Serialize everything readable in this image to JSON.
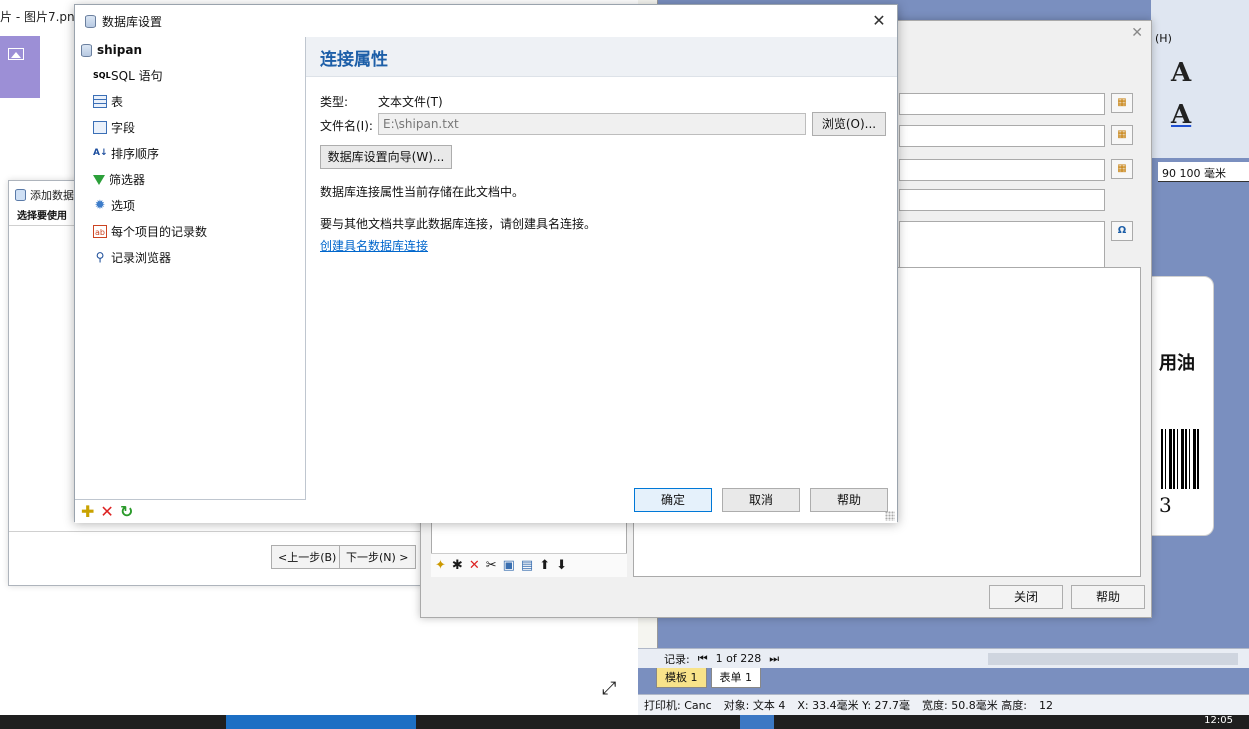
{
  "background": {
    "viewer_title": "片 - 图片7.png",
    "wizard": {
      "title": "添加数据",
      "subtitle": "选择要使用",
      "prev_button": "<上一步(B)",
      "next_button": "下一步(N) >"
    },
    "datasource": {
      "close_button": "关闭",
      "help_button": "帮助"
    },
    "designer": {
      "menu_help": "(H)",
      "ruler_text": "90    100 毫米",
      "label_text": "用油",
      "barcode_digit": "3",
      "record_label": "记录:",
      "record_value": "1 of 228",
      "sheet_tabs": [
        "模板 1",
        "表单 1"
      ],
      "status": {
        "printer": "打印机: Canc",
        "object": "对象: 文本 4",
        "coords": "X: 33.4毫米  Y: 27.7毫",
        "size": "宽度: 50.8毫米  高度:",
        "zoom": "12"
      }
    },
    "taskbar_time": "12:05"
  },
  "dialog": {
    "title": "数据库设置",
    "tree": {
      "root": "shipan",
      "items": [
        {
          "label": "SQL 语句",
          "icon": "sql-icon"
        },
        {
          "label": "表",
          "icon": "table-icon"
        },
        {
          "label": "字段",
          "icon": "field-icon"
        },
        {
          "label": "排序顺序",
          "icon": "sort-icon"
        },
        {
          "label": "筛选器",
          "icon": "filter-icon"
        },
        {
          "label": "选项",
          "icon": "gear-icon"
        },
        {
          "label": "每个项目的记录数",
          "icon": "records-icon"
        },
        {
          "label": "记录浏览器",
          "icon": "search-icon"
        }
      ]
    },
    "panel": {
      "heading": "连接属性",
      "type_label": "类型:",
      "type_value": "文本文件(T)",
      "file_label": "文件名(I):",
      "file_value": "E:\\shipan.txt",
      "browse_button": "浏览(O)...",
      "wizard_button": "数据库设置向导(W)...",
      "info_1": "数据库连接属性当前存储在此文档中。",
      "info_2": "要与其他文档共享此数据库连接，请创建具名连接。",
      "link": "创建具名数据库连接"
    },
    "buttons": {
      "ok": "确定",
      "cancel": "取消",
      "help": "帮助"
    }
  },
  "colors": {
    "heading": "#1d5fa8",
    "link": "#0066cc",
    "primary_border": "#0078d7",
    "designer_bg": "#7a8fbf"
  }
}
